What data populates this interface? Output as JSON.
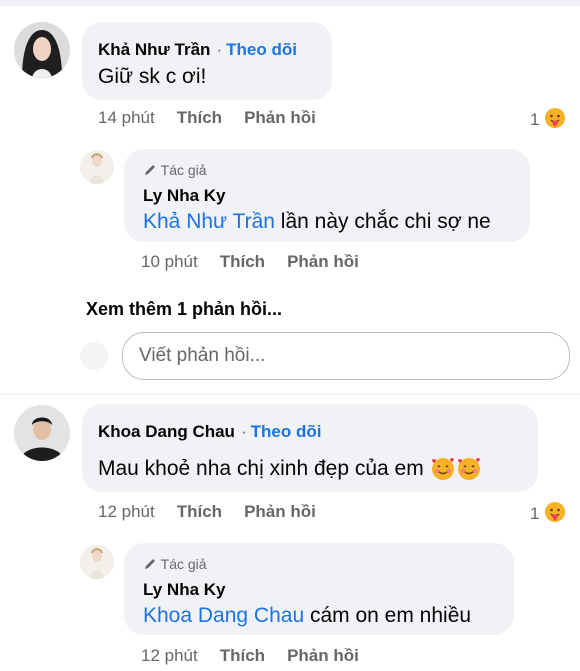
{
  "comments": [
    {
      "name": "Khả Như Trần",
      "separator": "·",
      "follow": "Theo dõi",
      "text": "Giữ sk c ơi!",
      "time": "14 phút",
      "like": "Thích",
      "reply": "Phản hồi",
      "reaction_count": "1",
      "reply_item": {
        "badge": "Tác giả",
        "name": "Ly Nha Ky",
        "mention": "Khả Như Trần",
        "text": " lần này chắc chi sợ ne",
        "time": "10 phút",
        "like": "Thích",
        "reply": "Phản hồi"
      }
    },
    {
      "name": "Khoa Dang Chau",
      "separator": "·",
      "follow": "Theo dõi",
      "text": "Mau khoẻ nha chị xinh đẹp của em",
      "time": "12 phút",
      "like": "Thích",
      "reply": "Phản hồi",
      "reaction_count": "1",
      "reply_item": {
        "badge": "Tác giả",
        "name": "Ly Nha Ky",
        "mention": "Khoa Dang Chau",
        "text": " cám on em nhiều",
        "time": "12 phút",
        "like": "Thích",
        "reply": "Phản hồi"
      }
    }
  ],
  "see_more": "Xem thêm 1 phản hồi...",
  "reply_input": {
    "placeholder": "Viết phản hồi..."
  },
  "icons": {
    "pencil": "pencil-icon",
    "reaction": "care-reaction-icon",
    "emoji": "smiling-face-with-hearts-emoji"
  },
  "colors": {
    "link": "#1b74e4",
    "bubble": "#f0f2f5",
    "meta": "#65676b"
  }
}
